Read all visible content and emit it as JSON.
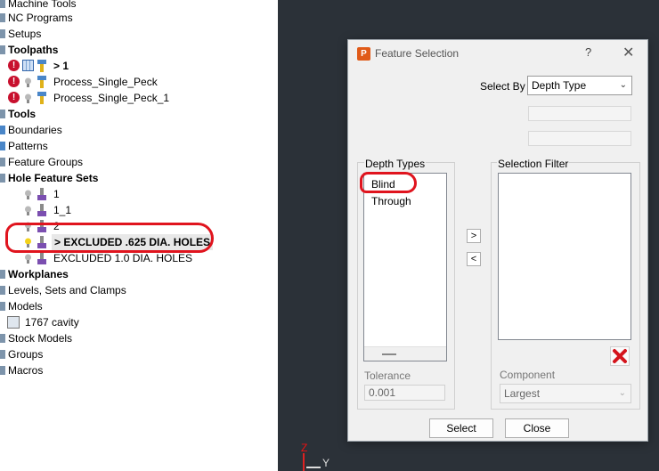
{
  "tree": {
    "items": [
      {
        "label": "Machine Tools",
        "bold": false
      },
      {
        "label": "NC Programs",
        "bold": false
      },
      {
        "label": "Setups",
        "bold": false
      },
      {
        "label": "Toolpaths",
        "bold": true
      },
      {
        "label": "> 1",
        "bold": true
      },
      {
        "label": "Process_Single_Peck",
        "bold": false
      },
      {
        "label": "Process_Single_Peck_1",
        "bold": false
      },
      {
        "label": "Tools",
        "bold": true
      },
      {
        "label": "Boundaries",
        "bold": false
      },
      {
        "label": "Patterns",
        "bold": false
      },
      {
        "label": "Feature Groups",
        "bold": false
      },
      {
        "label": "Hole Feature Sets",
        "bold": true
      },
      {
        "label": "1",
        "bold": false
      },
      {
        "label": "1_1",
        "bold": false
      },
      {
        "label": "2",
        "bold": false
      },
      {
        "label": "> EXCLUDED .625 DIA. HOLES",
        "bold": true
      },
      {
        "label": "EXCLUDED 1.0 DIA. HOLES",
        "bold": false
      },
      {
        "label": "Workplanes",
        "bold": true
      },
      {
        "label": "Levels, Sets and Clamps",
        "bold": false
      },
      {
        "label": "Models",
        "bold": false
      },
      {
        "label": "1767 cavity",
        "bold": false
      },
      {
        "label": "Stock Models",
        "bold": false
      },
      {
        "label": "Groups",
        "bold": false
      },
      {
        "label": "Macros",
        "bold": false
      }
    ],
    "error_glyph": "!"
  },
  "viewport": {
    "axis_z": "Z",
    "axis_y": "Y"
  },
  "dialog": {
    "app_icon": "P",
    "title": "Feature Selection",
    "help": "?",
    "close": "✕",
    "select_by_label": "Select By",
    "select_by_value": "Depth Type",
    "depth_types_label": "Depth Types",
    "depth_types": [
      "Blind",
      "Through"
    ],
    "selection_filter_label": "Selection Filter",
    "add_arrow": ">",
    "remove_arrow": "<",
    "tolerance_label": "Tolerance",
    "tolerance_value": "0.001",
    "component_label": "Component",
    "component_value": "Largest",
    "select_button": "Select",
    "close_button": "Close",
    "accent_red": "#e0141e"
  }
}
